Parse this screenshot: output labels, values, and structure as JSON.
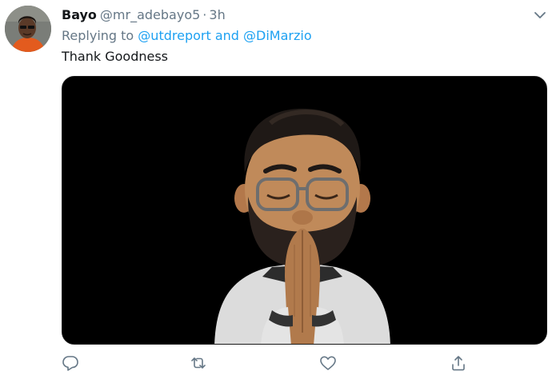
{
  "tweet": {
    "author_name": "Bayo",
    "author_handle": "@mr_adebayo5",
    "separator": "·",
    "time": "3h",
    "replying_prefix": "Replying to",
    "reply_user_1": "@utdreport",
    "reply_conjunction": "and",
    "reply_user_2": "@DiMarzio",
    "text": "Thank Goodness"
  },
  "icons": {
    "caret": "chevron-down-icon",
    "reply": "reply-icon",
    "retweet": "retweet-icon",
    "like": "heart-icon",
    "share": "share-icon"
  },
  "colors": {
    "link": "#1da1f2",
    "secondary_text": "#657786",
    "primary_text": "#14171a",
    "media_background": "#000000"
  }
}
